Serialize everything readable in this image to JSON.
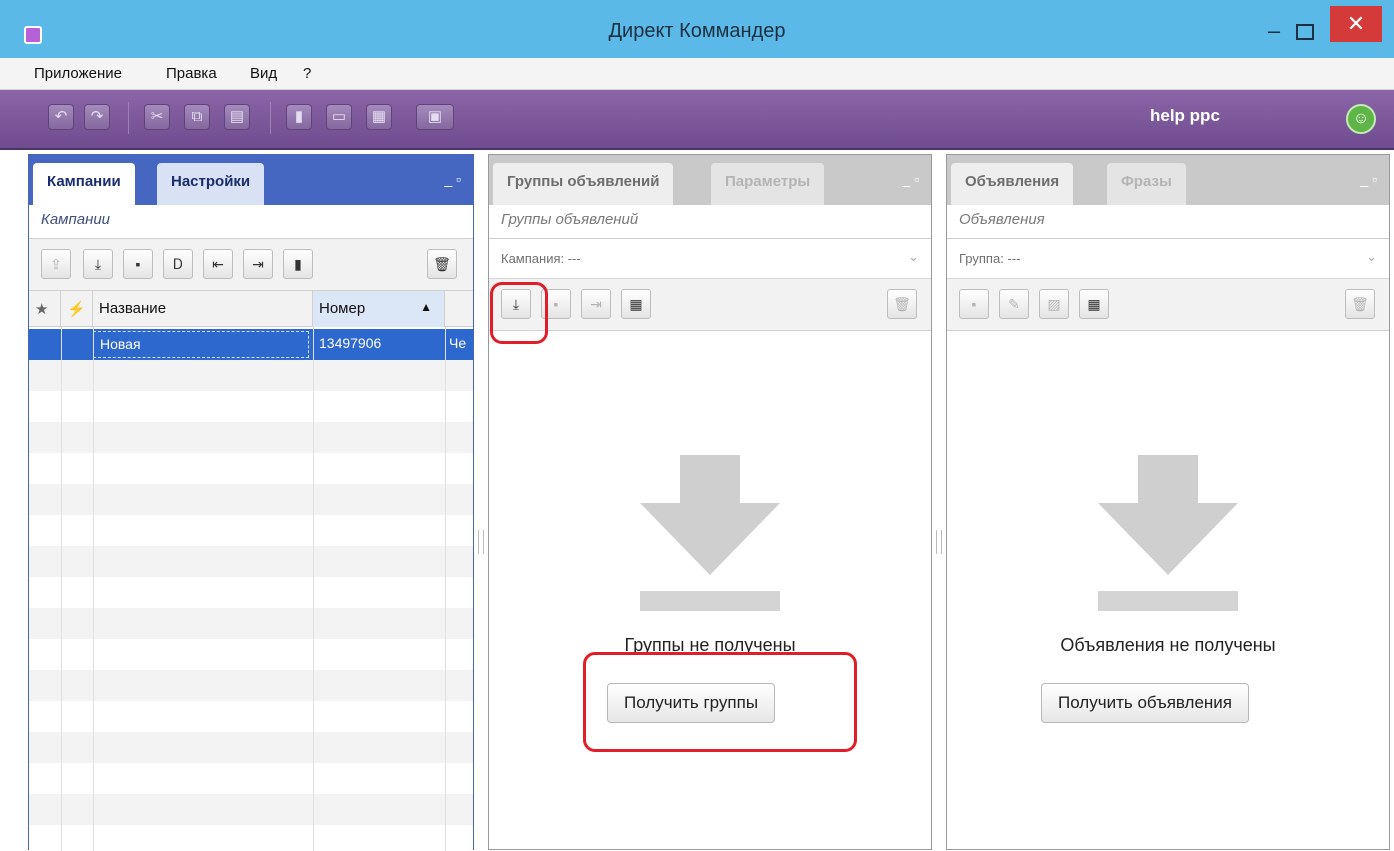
{
  "window": {
    "title": "Директ Коммандер",
    "minimize": "‒",
    "close": "✕"
  },
  "menu": [
    "Приложение",
    "Правка",
    "Вид",
    "?"
  ],
  "toolbar": {
    "user_label": "help ppc",
    "buttons": [
      {
        "icon": "undo-icon",
        "glyph": "↶"
      },
      {
        "icon": "redo-icon",
        "glyph": "↷"
      },
      {
        "icon": "cut-icon",
        "glyph": "✂"
      },
      {
        "icon": "copy-icon",
        "glyph": "⧉"
      },
      {
        "icon": "paste-icon",
        "glyph": "▤"
      },
      {
        "icon": "bar-chart-icon",
        "glyph": "▮"
      },
      {
        "icon": "ellipsis-icon",
        "glyph": "▭"
      },
      {
        "icon": "grid-icon",
        "glyph": "▦"
      },
      {
        "icon": "layout-dropdown-icon",
        "glyph": "▣"
      }
    ]
  },
  "campaigns_panel": {
    "tab_active": "Кампании",
    "tab_inactive": "Настройки",
    "subtitle": "Кампании",
    "columns": {
      "star": "★",
      "flag": "⚡",
      "name": "Название",
      "number": "Номер",
      "sort_arrow": "▲"
    },
    "rows": [
      {
        "name": "Новая",
        "number": "13497906",
        "extra": "Че"
      }
    ]
  },
  "groups_panel": {
    "tab_active": "Группы объявлений",
    "tab_inactive": "Параметры",
    "subtitle": "Группы объявлений",
    "filter_label": "Кампания: ---",
    "empty_text": "Группы не получены",
    "button": "Получить группы"
  },
  "ads_panel": {
    "tab_active": "Объявления",
    "tab_inactive": "Фразы",
    "subtitle": "Объявления",
    "filter_label": "Группа: ---",
    "empty_text": "Объявления не получены",
    "button": "Получить объявления"
  },
  "colors": {
    "titlebar": "#5bb9e8",
    "toolbar": "#7a579a",
    "selected_row": "#2d68cf",
    "highlight": "#e01e2a"
  }
}
